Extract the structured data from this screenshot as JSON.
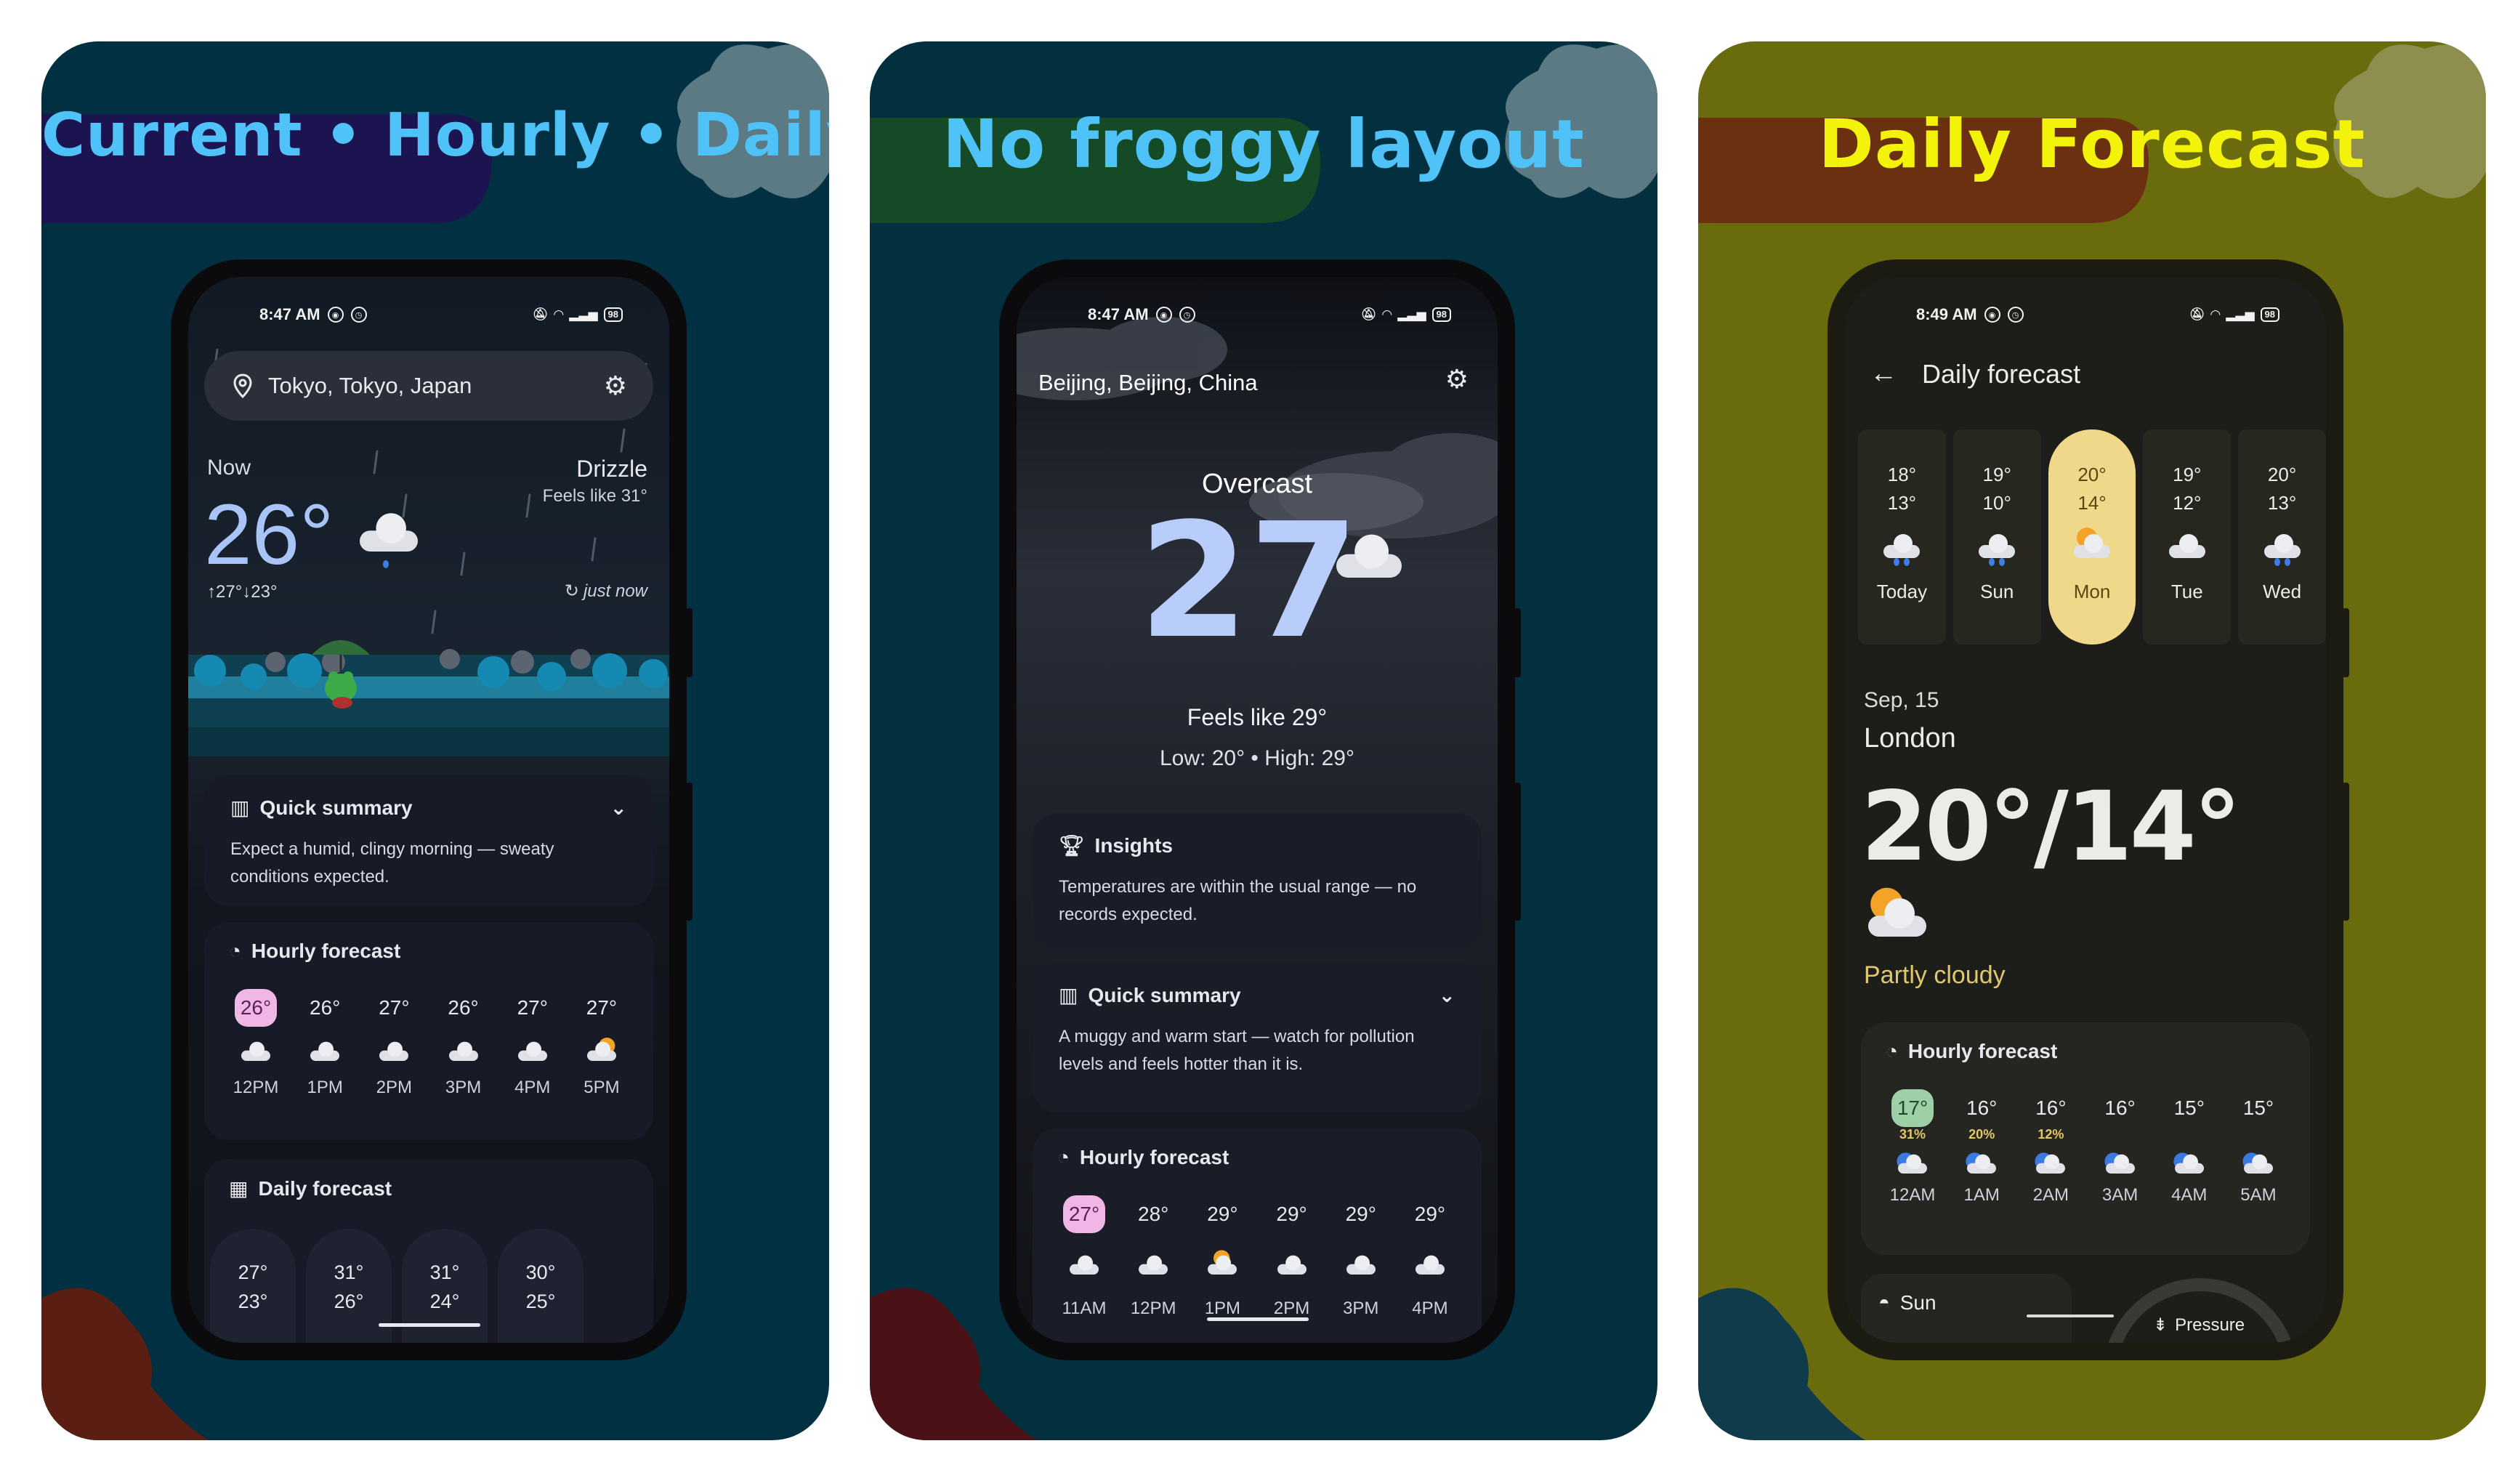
{
  "cards": [
    {
      "headline": "Current • Hourly • Daily",
      "headline_color": "#4fc3f7",
      "phone": {
        "status": {
          "time": "8:47 AM",
          "battery": "98"
        },
        "location": "Tokyo, Tokyo, Japan",
        "now_label": "Now",
        "condition": "Drizzle",
        "feels_like": "Feels like 31°",
        "temperature": "26°",
        "hi_lo": "↑27°↓23°",
        "updated": "just now",
        "quick_summary": {
          "title": "Quick summary",
          "text": "Expect a humid, clingy morning — sweaty conditions expected."
        },
        "hourly": {
          "title": "Hourly forecast",
          "items": [
            {
              "temp": "26°",
              "time": "12PM",
              "icon": "cloud-rain-icon"
            },
            {
              "temp": "26°",
              "time": "1PM",
              "icon": "cloud-rain-icon"
            },
            {
              "temp": "27°",
              "time": "2PM",
              "icon": "cloud-icon"
            },
            {
              "temp": "26°",
              "time": "3PM",
              "icon": "cloud-rain-icon"
            },
            {
              "temp": "27°",
              "time": "4PM",
              "icon": "cloud-icon"
            },
            {
              "temp": "27°",
              "time": "5PM",
              "icon": "partly-cloudy-icon"
            }
          ]
        },
        "daily": {
          "title": "Daily forecast",
          "items": [
            {
              "hi": "27°",
              "lo": "23°"
            },
            {
              "hi": "31°",
              "lo": "26°"
            },
            {
              "hi": "31°",
              "lo": "24°"
            },
            {
              "hi": "30°",
              "lo": "25°"
            }
          ]
        }
      }
    },
    {
      "headline": "No froggy layout",
      "headline_color": "#4fc3f7",
      "phone": {
        "status": {
          "time": "8:47 AM",
          "battery": "98"
        },
        "location": "Beijing, Beijing, China",
        "condition": "Overcast",
        "temperature": "27",
        "feels_like": "Feels like 29°",
        "low_high": "Low: 20° • High: 29°",
        "insights": {
          "title": "Insights",
          "text": "Temperatures are within the usual range — no records expected."
        },
        "quick_summary": {
          "title": "Quick summary",
          "text": "A muggy and warm start — watch for pollution levels and feels hotter than it is."
        },
        "hourly": {
          "title": "Hourly forecast",
          "items": [
            {
              "temp": "27°",
              "time": "11AM",
              "icon": "cloud-icon"
            },
            {
              "temp": "28°",
              "time": "12PM",
              "icon": "cloud-icon"
            },
            {
              "temp": "29°",
              "time": "1PM",
              "icon": "partly-cloudy-icon"
            },
            {
              "temp": "29°",
              "time": "2PM",
              "icon": "cloud-icon"
            },
            {
              "temp": "29°",
              "time": "3PM",
              "icon": "cloud-icon"
            },
            {
              "temp": "29°",
              "time": "4PM",
              "icon": "cloud-icon"
            }
          ]
        }
      }
    },
    {
      "headline": "Daily  Forecast",
      "headline_color": "#f2f20a",
      "phone": {
        "status": {
          "time": "8:49 AM",
          "battery": "98"
        },
        "title": "Daily forecast",
        "days": [
          {
            "hi": "18°",
            "lo": "13°",
            "name": "Today",
            "icon": "cloud-rain-icon"
          },
          {
            "hi": "19°",
            "lo": "10°",
            "name": "Sun",
            "icon": "cloud-rain-icon"
          },
          {
            "hi": "20°",
            "lo": "14°",
            "name": "Mon",
            "icon": "partly-cloudy-icon"
          },
          {
            "hi": "19°",
            "lo": "12°",
            "name": "Tue",
            "icon": "cloud-icon"
          },
          {
            "hi": "20°",
            "lo": "13°",
            "name": "Wed",
            "icon": "cloud-rain-icon"
          }
        ],
        "date": "Sep, 15",
        "city": "London",
        "temps": "20°/14°",
        "condition": "Partly cloudy",
        "hourly": {
          "title": "Hourly forecast",
          "items": [
            {
              "temp": "17°",
              "prec": "31%",
              "time": "12AM"
            },
            {
              "temp": "16°",
              "prec": "20%",
              "time": "1AM"
            },
            {
              "temp": "16°",
              "prec": "12%",
              "time": "2AM"
            },
            {
              "temp": "16°",
              "prec": "",
              "time": "3AM"
            },
            {
              "temp": "15°",
              "prec": "",
              "time": "4AM"
            },
            {
              "temp": "15°",
              "prec": "",
              "time": "5AM"
            }
          ]
        },
        "sun_label": "Sun",
        "pressure_label": "Pressure"
      }
    }
  ]
}
